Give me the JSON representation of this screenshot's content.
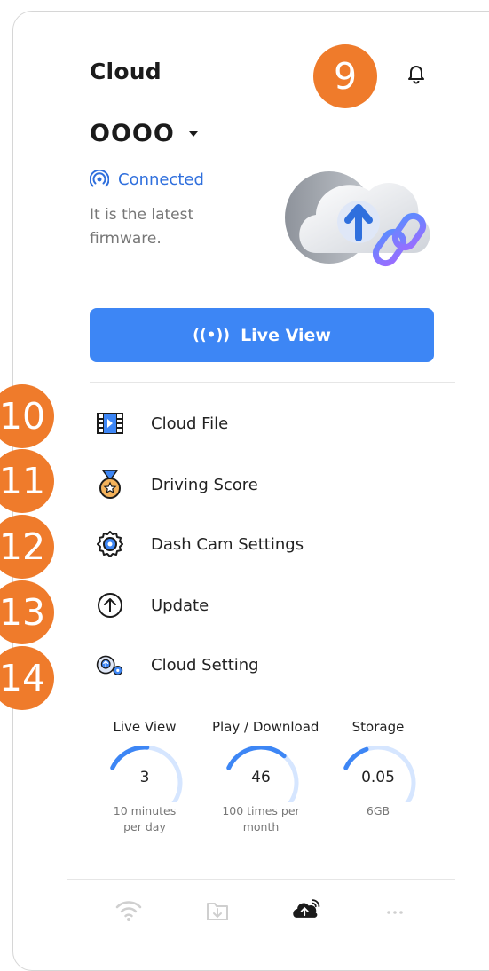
{
  "header": {
    "title": "Cloud",
    "notification_count": "9"
  },
  "device": {
    "name": "OOOO"
  },
  "status": {
    "connection": "Connected",
    "firmware": "It is the latest firmware."
  },
  "live_view_button": {
    "label": "Live View"
  },
  "menu": {
    "items": [
      {
        "label": "Cloud File",
        "callout": "10",
        "icon": "film-icon"
      },
      {
        "label": "Driving Score",
        "callout": "11",
        "icon": "medal-icon"
      },
      {
        "label": "Dash Cam Settings",
        "callout": "12",
        "icon": "gear-icon"
      },
      {
        "label": "Update",
        "callout": "13",
        "icon": "arrow-up-circle-icon"
      },
      {
        "label": "Cloud Setting",
        "callout": "14",
        "icon": "cloud-gear-icon"
      }
    ]
  },
  "stats": [
    {
      "title": "Live View",
      "value": "3",
      "subtitle_line1": "10 minutes",
      "subtitle_line2": "per day",
      "fraction": 0.3
    },
    {
      "title": "Play / Download",
      "value": "46",
      "subtitle_line1": "100 times per",
      "subtitle_line2": "month",
      "fraction": 0.46
    },
    {
      "title": "Storage",
      "value": "0.05",
      "subtitle_line1": "6GB",
      "subtitle_line2": "",
      "fraction": 0.2
    }
  ],
  "bottom_nav": {
    "items": [
      {
        "icon": "wifi-icon",
        "active": false
      },
      {
        "icon": "download-folder-icon",
        "active": false
      },
      {
        "icon": "cloud-upload-icon",
        "active": true
      },
      {
        "icon": "more-icon",
        "active": false
      }
    ]
  },
  "colors": {
    "accent": "#3d86f5",
    "callout": "#ef7b2b",
    "gauge_track": "#d6e6ff",
    "gauge_fill": "#3d86f5"
  }
}
